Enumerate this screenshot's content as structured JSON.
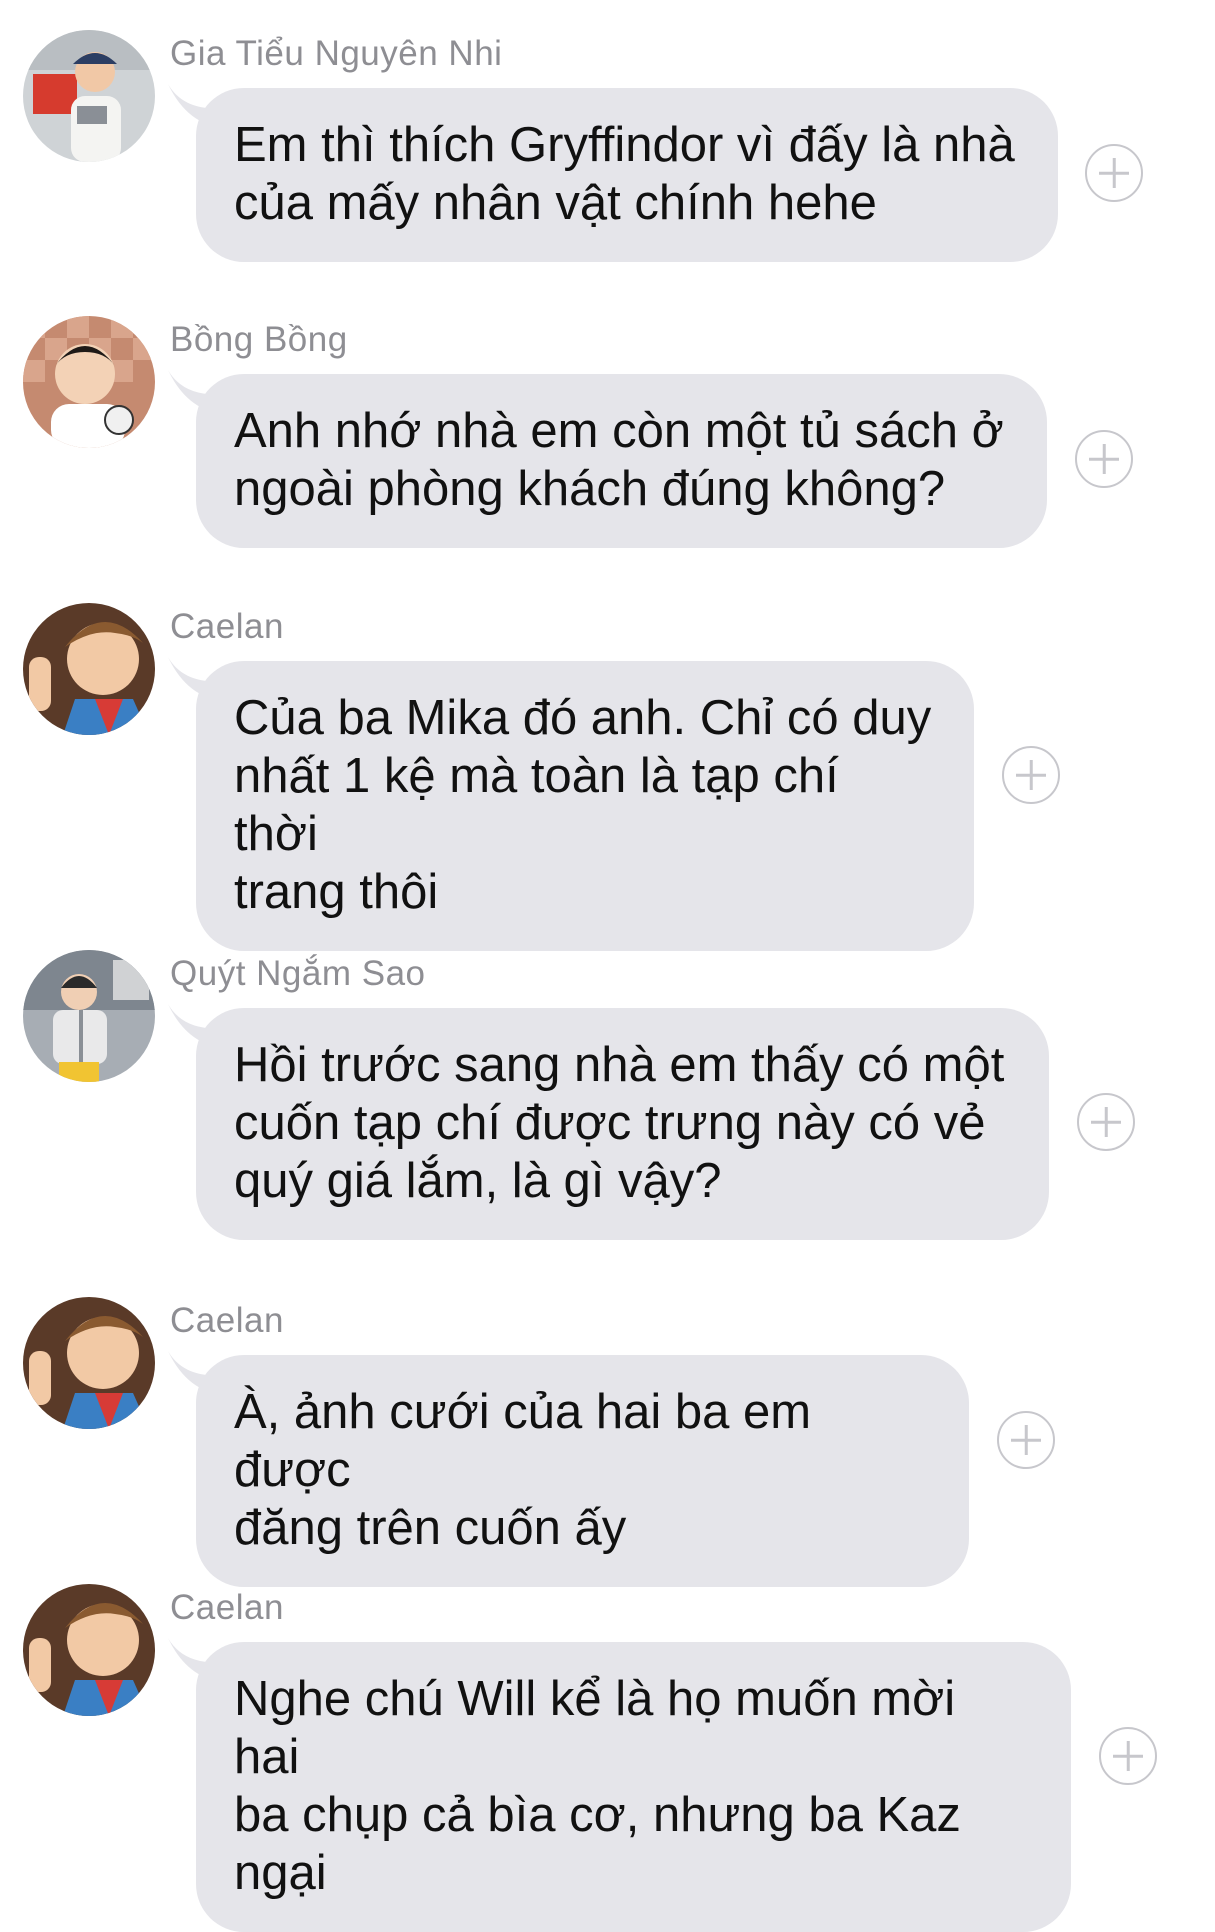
{
  "messages": [
    {
      "sender": "Gia Tiểu Nguyên Nhi",
      "avatar": "child-photo-icon",
      "text": "Em thì thích Gryffindor vì đấy là nhà\ncủa mấy nhân vật chính hehe"
    },
    {
      "sender": "Bồng Bồng",
      "avatar": "child-photo-icon",
      "text": "Anh nhớ nhà em còn một tủ sách ở\nngoài phòng khách đúng không?"
    },
    {
      "sender": "Caelan",
      "avatar": "child-photo-icon",
      "text": "Của ba Mika đó anh. Chỉ có duy\nnhất 1 kệ mà toàn là tạp chí thời\ntrang thôi"
    },
    {
      "sender": "Quýt Ngắm Sao",
      "avatar": "child-photo-icon",
      "text": "Hồi trước sang nhà em thấy có một\ncuốn tạp chí được trưng này có vẻ\nquý giá lắm, là gì vậy?"
    },
    {
      "sender": "Caelan",
      "avatar": "child-photo-icon",
      "text": "À, ảnh cưới của hai ba em được\nđăng trên cuốn ấy"
    },
    {
      "sender": "Caelan",
      "avatar": "child-photo-icon",
      "text": "Nghe chú Will kể là họ muốn mời hai\nba chụp cả bìa cơ, nhưng ba Kaz\nngại"
    }
  ],
  "reaction_icon": "add-reaction-icon",
  "colors": {
    "bubble": "#e5e5ea",
    "sender_text": "#8e8e93",
    "message_text": "#111111",
    "plus_icon": "#c7c7cc"
  }
}
